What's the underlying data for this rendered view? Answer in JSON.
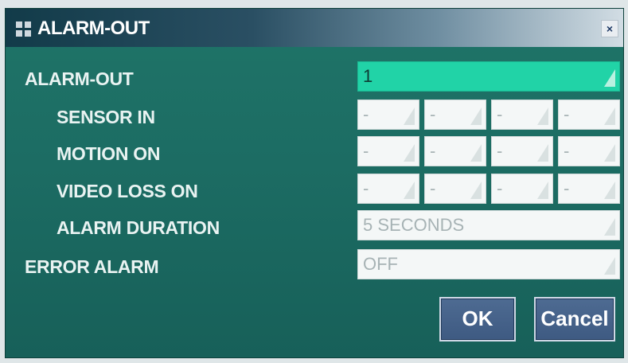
{
  "window": {
    "title": "ALARM-OUT",
    "close_label": "×"
  },
  "rows": {
    "alarm_out": {
      "label": "ALARM-OUT",
      "value": "1"
    },
    "sensor_in": {
      "label": "SENSOR IN",
      "values": [
        "-",
        "-",
        "-",
        "-"
      ]
    },
    "motion_on": {
      "label": "MOTION ON",
      "values": [
        "-",
        "-",
        "-",
        "-"
      ]
    },
    "video_loss_on": {
      "label": "VIDEO LOSS ON",
      "values": [
        "-",
        "-",
        "-",
        "-"
      ]
    },
    "alarm_duration": {
      "label": "ALARM DURATION",
      "value": "5 SECONDS"
    },
    "error_alarm": {
      "label": "ERROR ALARM",
      "value": "OFF"
    }
  },
  "buttons": {
    "ok": "OK",
    "cancel": "Cancel"
  },
  "colors": {
    "panel": "#1c6c63",
    "selected_field": "#21d3a7",
    "button": "#3e5a82"
  }
}
